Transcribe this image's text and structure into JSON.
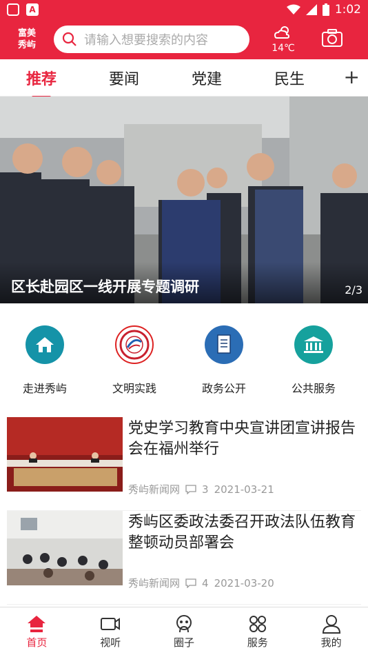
{
  "status": {
    "time": "1:02"
  },
  "header": {
    "brand_line1": "富美",
    "brand_line2": "秀屿",
    "search_placeholder": "请输入想要搜索的内容",
    "weather_temp": "14℃"
  },
  "tabs": [
    {
      "label": "推荐",
      "active": true
    },
    {
      "label": "要闻"
    },
    {
      "label": "党建"
    },
    {
      "label": "民生"
    }
  ],
  "banner": {
    "caption": "区长赴园区一线开展专题调研",
    "pager": "2/3"
  },
  "quick": [
    {
      "label": "走进秀屿",
      "icon": "house-icon",
      "color": "#1593a8"
    },
    {
      "label": "文明实践",
      "icon": "civilization-emblem-icon",
      "color": "#ffffff"
    },
    {
      "label": "政务公开",
      "icon": "document-icon",
      "color": "#2b6db5"
    },
    {
      "label": "公共服务",
      "icon": "government-building-icon",
      "color": "#16a19d"
    }
  ],
  "news": [
    {
      "title": "党史学习教育中央宣讲团宣讲报告会在福州举行",
      "source": "秀屿新闻网",
      "comments": "3",
      "date": "2021-03-21"
    },
    {
      "title": "秀屿区委政法委召开政法队伍教育整顿动员部署会",
      "source": "秀屿新闻网",
      "comments": "4",
      "date": "2021-03-20"
    }
  ],
  "bottom_nav": [
    {
      "label": "首页",
      "icon": "home-icon",
      "active": true
    },
    {
      "label": "视听",
      "icon": "video-icon"
    },
    {
      "label": "圈子",
      "icon": "circle-icon"
    },
    {
      "label": "服务",
      "icon": "grid-icon"
    },
    {
      "label": "我的",
      "icon": "user-icon"
    }
  ],
  "colors": {
    "brand": "#e8253f"
  }
}
